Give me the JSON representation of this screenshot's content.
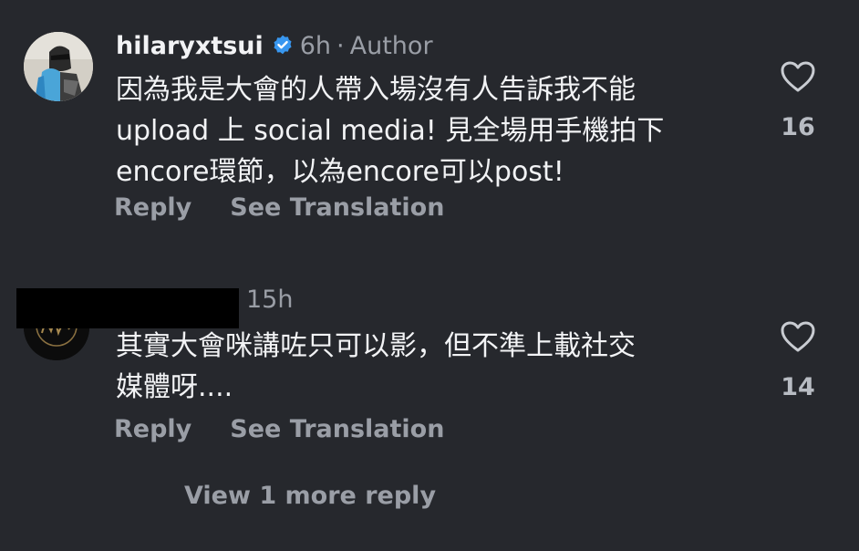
{
  "comments": [
    {
      "username": "hilaryxtsui",
      "verified": true,
      "time": "6h",
      "separator": "·",
      "badge": "Author",
      "text": "因為我是大會的人帶入場沒有人告訴我不能\nupload 上 social media! 見全場用手機拍下\nencore環節，以為encore可以post!",
      "reply_label": "Reply",
      "translate_label": "See Translation",
      "likes": "16"
    },
    {
      "username": "",
      "time": "15h",
      "text": "其實大會咪講咗只可以影，但不準上載社交\n媒體呀....",
      "reply_label": "Reply",
      "translate_label": "See Translation",
      "likes": "14"
    }
  ],
  "view_more": "View 1 more reply",
  "colors": {
    "background": "#26282d",
    "text": "#f2f3f5",
    "muted": "#9a9ea6",
    "verified": "#3897f0"
  },
  "icons": [
    "verified-badge-icon",
    "heart-icon"
  ]
}
